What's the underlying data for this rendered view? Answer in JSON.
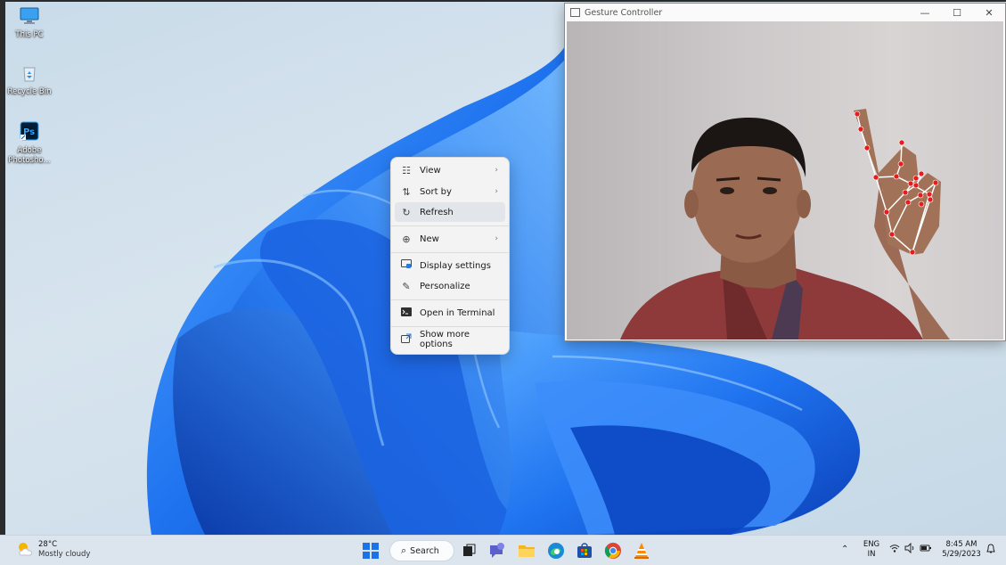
{
  "desktop": {
    "icons": [
      {
        "label": "This PC",
        "icon": "monitor-icon"
      },
      {
        "label": "Recycle Bin",
        "icon": "recycle-bin-icon"
      },
      {
        "label": "Adobe Photosho...",
        "icon": "photoshop-icon"
      }
    ]
  },
  "context_menu": {
    "items": [
      {
        "label": "View",
        "icon": "grid-icon",
        "submenu": true
      },
      {
        "label": "Sort by",
        "icon": "sort-icon",
        "submenu": true
      },
      {
        "label": "Refresh",
        "icon": "refresh-icon",
        "submenu": false,
        "highlighted": true
      },
      {
        "label": "New",
        "icon": "plus-circle-icon",
        "submenu": true
      },
      {
        "label": "Display settings",
        "icon": "display-icon",
        "submenu": false
      },
      {
        "label": "Personalize",
        "icon": "brush-icon",
        "submenu": false
      },
      {
        "label": "Open in Terminal",
        "icon": "terminal-icon",
        "submenu": false
      },
      {
        "label": "Show more options",
        "icon": "share-icon",
        "submenu": false
      }
    ]
  },
  "gesture_window": {
    "title": "Gesture Controller",
    "controls": {
      "minimize": "—",
      "maximize": "☐",
      "close": "✕"
    }
  },
  "taskbar": {
    "weather": {
      "temp": "28°C",
      "condition": "Mostly cloudy"
    },
    "search_label": "Search",
    "apps": [
      "start-icon",
      "task-view-icon",
      "chat-icon",
      "file-explorer-icon",
      "edge-icon",
      "store-icon",
      "chrome-icon",
      "vlc-icon"
    ],
    "tray": {
      "language": "ENG",
      "region": "IN",
      "time": "8:45 AM",
      "date": "5/29/2023"
    }
  },
  "colors": {
    "accent": "#0a5cd6",
    "taskbar": "#dce5ee",
    "menu": "#f3f3f3",
    "landmark": "#e81c1c"
  }
}
